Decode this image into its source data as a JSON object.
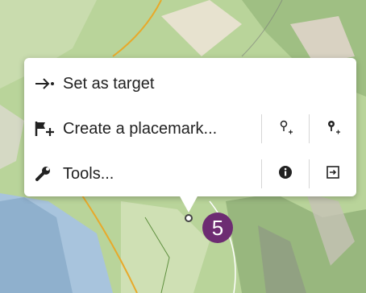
{
  "popup_menu": {
    "items": [
      {
        "label": "Set as target",
        "icon": "arrow-right-dot-icon"
      },
      {
        "label": "Create a placemark...",
        "icon": "flag-plus-icon",
        "actions": [
          {
            "icon": "lightbulb-plus-icon"
          },
          {
            "icon": "gear-pin-plus-icon"
          }
        ]
      },
      {
        "label": "Tools...",
        "icon": "wrench-icon",
        "actions": [
          {
            "icon": "info-icon"
          },
          {
            "icon": "export-box-icon"
          }
        ]
      }
    ]
  },
  "step_badge": {
    "number": "5",
    "color": "#6d2c72"
  },
  "colors": {
    "map_green": "#b9d49a",
    "map_water": "#a8c4dd",
    "popup_bg": "#ffffff",
    "text": "#222222",
    "divider": "#d6d6d6"
  }
}
